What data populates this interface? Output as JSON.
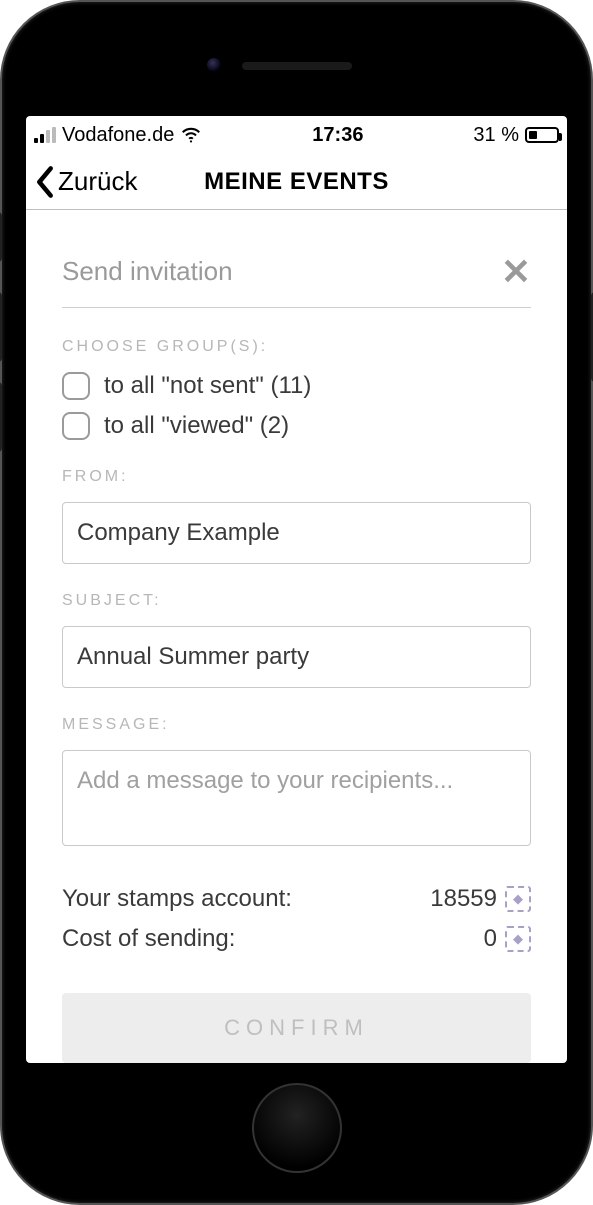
{
  "statusbar": {
    "carrier": "Vodafone.de",
    "time": "17:36",
    "battery_pct": "31 %"
  },
  "nav": {
    "back_label": "Zurück",
    "title": "MEINE EVENTS"
  },
  "section": {
    "title": "Send invitation"
  },
  "groups": {
    "label": "CHOOSE GROUP(S):",
    "options": [
      "to all \"not sent\" (11)",
      "to all \"viewed\" (2)"
    ]
  },
  "from": {
    "label": "FROM:",
    "value": "Company Example"
  },
  "subject": {
    "label": "SUBJECT:",
    "value": "Annual Summer party"
  },
  "message": {
    "label": "MESSAGE:",
    "placeholder": "Add a message to your recipients...",
    "value": ""
  },
  "stamps": {
    "account_label": "Your stamps account:",
    "account_value": "18559",
    "cost_label": "Cost of sending:",
    "cost_value": "0"
  },
  "confirm_label": "CONFIRM"
}
